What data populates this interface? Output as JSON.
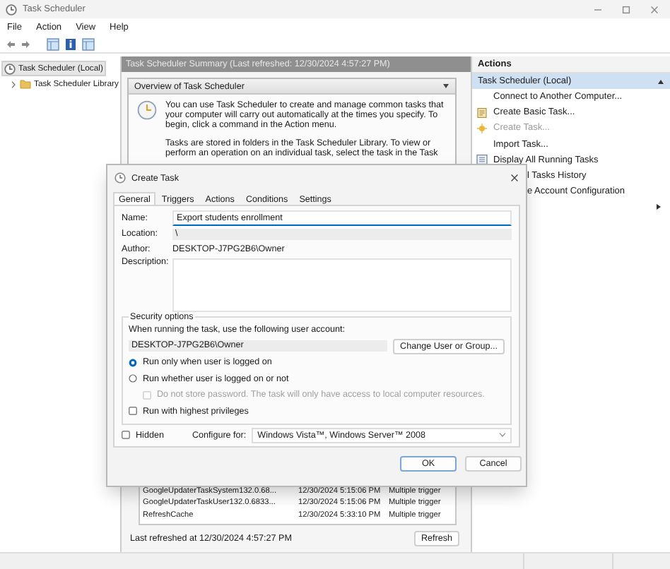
{
  "window": {
    "title": "Task Scheduler"
  },
  "menu": [
    "File",
    "Action",
    "View",
    "Help"
  ],
  "tree": {
    "items": [
      {
        "label": "Task Scheduler (Local)",
        "selected": true,
        "children": [
          {
            "label": "Task Scheduler Library",
            "selected": false,
            "expanded": false
          }
        ]
      }
    ]
  },
  "summary": {
    "header": "Task Scheduler Summary (Last refreshed: 12/30/2024 4:57:27 PM)",
    "overview_title": "Overview of Task Scheduler",
    "paragraphs": [
      "You can use Task Scheduler to create and manage common tasks that your computer will carry out automatically at the times you specify. To begin, click a command in the Action menu.",
      "Tasks are stored in folders in the Task Scheduler Library. To view or perform an operation on an individual task, select the task in the Task"
    ],
    "task_rows": [
      {
        "cells": [
          "GoogleUpdaterTaskSystem132.0.68...",
          "12/30/2024 5:15:06 PM",
          "Multiple trigger"
        ]
      },
      {
        "cells": [
          "GoogleUpdaterTaskUser132.0.6833...",
          "12/30/2024 5:15:06 PM",
          "Multiple trigger"
        ]
      },
      {
        "cells": [
          "RefreshCache",
          "12/30/2024 5:33:10 PM",
          "Multiple trigger"
        ]
      }
    ],
    "last_refreshed": "Last refreshed at 12/30/2024 4:57:27 PM",
    "refresh_button": "Refresh"
  },
  "actions": {
    "title": "Actions",
    "group": "Task Scheduler (Local)",
    "expanded": true,
    "items": [
      {
        "label": "Connect to Another Computer...",
        "kind": "plain",
        "disabled": false
      },
      {
        "label": "Create Basic Task...",
        "kind": "basic-task",
        "disabled": false
      },
      {
        "label": "Create Task...",
        "kind": "new-task",
        "disabled": true
      },
      {
        "label": "Import Task...",
        "kind": "plain",
        "disabled": false
      },
      {
        "label": "Display All Running Tasks",
        "kind": "running-list",
        "disabled": false
      },
      {
        "label": "l Tasks History",
        "kind": "cut",
        "disabled": false
      },
      {
        "label": "e Account Configuration",
        "kind": "cut",
        "disabled": false
      },
      {
        "kind": "submenu",
        "disabled": false
      }
    ]
  },
  "dialog": {
    "title": "Create Task",
    "tabs": [
      {
        "label": "General",
        "selected": true
      },
      {
        "label": "Triggers",
        "selected": false
      },
      {
        "label": "Actions",
        "selected": false
      },
      {
        "label": "Conditions",
        "selected": false
      },
      {
        "label": "Settings",
        "selected": false
      }
    ],
    "fields": [
      {
        "label": "Name:",
        "value": "Export students enrollment",
        "kind": "input"
      },
      {
        "label": "Location:",
        "value": "\\",
        "kind": "readonly"
      },
      {
        "label": "Author:",
        "value": "DESKTOP-J7PG2B6\\Owner",
        "kind": "text"
      },
      {
        "label": "Description:",
        "kind": "textarea"
      }
    ],
    "security": {
      "title": "Security options",
      "prompt": "When running the task, use the following user account:",
      "account": "DESKTOP-J7PG2B6\\Owner",
      "change_button": "Change User or Group...",
      "options": [
        {
          "label": "Run only when user is logged on",
          "kind": "radio",
          "selected": true,
          "disabled": false
        },
        {
          "label": "Run whether user is logged on or not",
          "kind": "radio",
          "selected": false,
          "disabled": false
        },
        {
          "label": "Do not store password.  The task will only have access to local computer resources.",
          "kind": "checkbox",
          "checked": false,
          "disabled": true
        },
        {
          "label": "Run with highest privileges",
          "kind": "checkbox",
          "checked": false,
          "disabled": false
        }
      ]
    },
    "hidden": {
      "label": "Hidden",
      "checked": false
    },
    "configure": {
      "label": "Configure for:",
      "value": "Windows Vista™, Windows Server™ 2008"
    },
    "buttons": [
      {
        "label": "OK",
        "kind": "default"
      },
      {
        "label": "Cancel",
        "kind": "normal"
      }
    ]
  }
}
